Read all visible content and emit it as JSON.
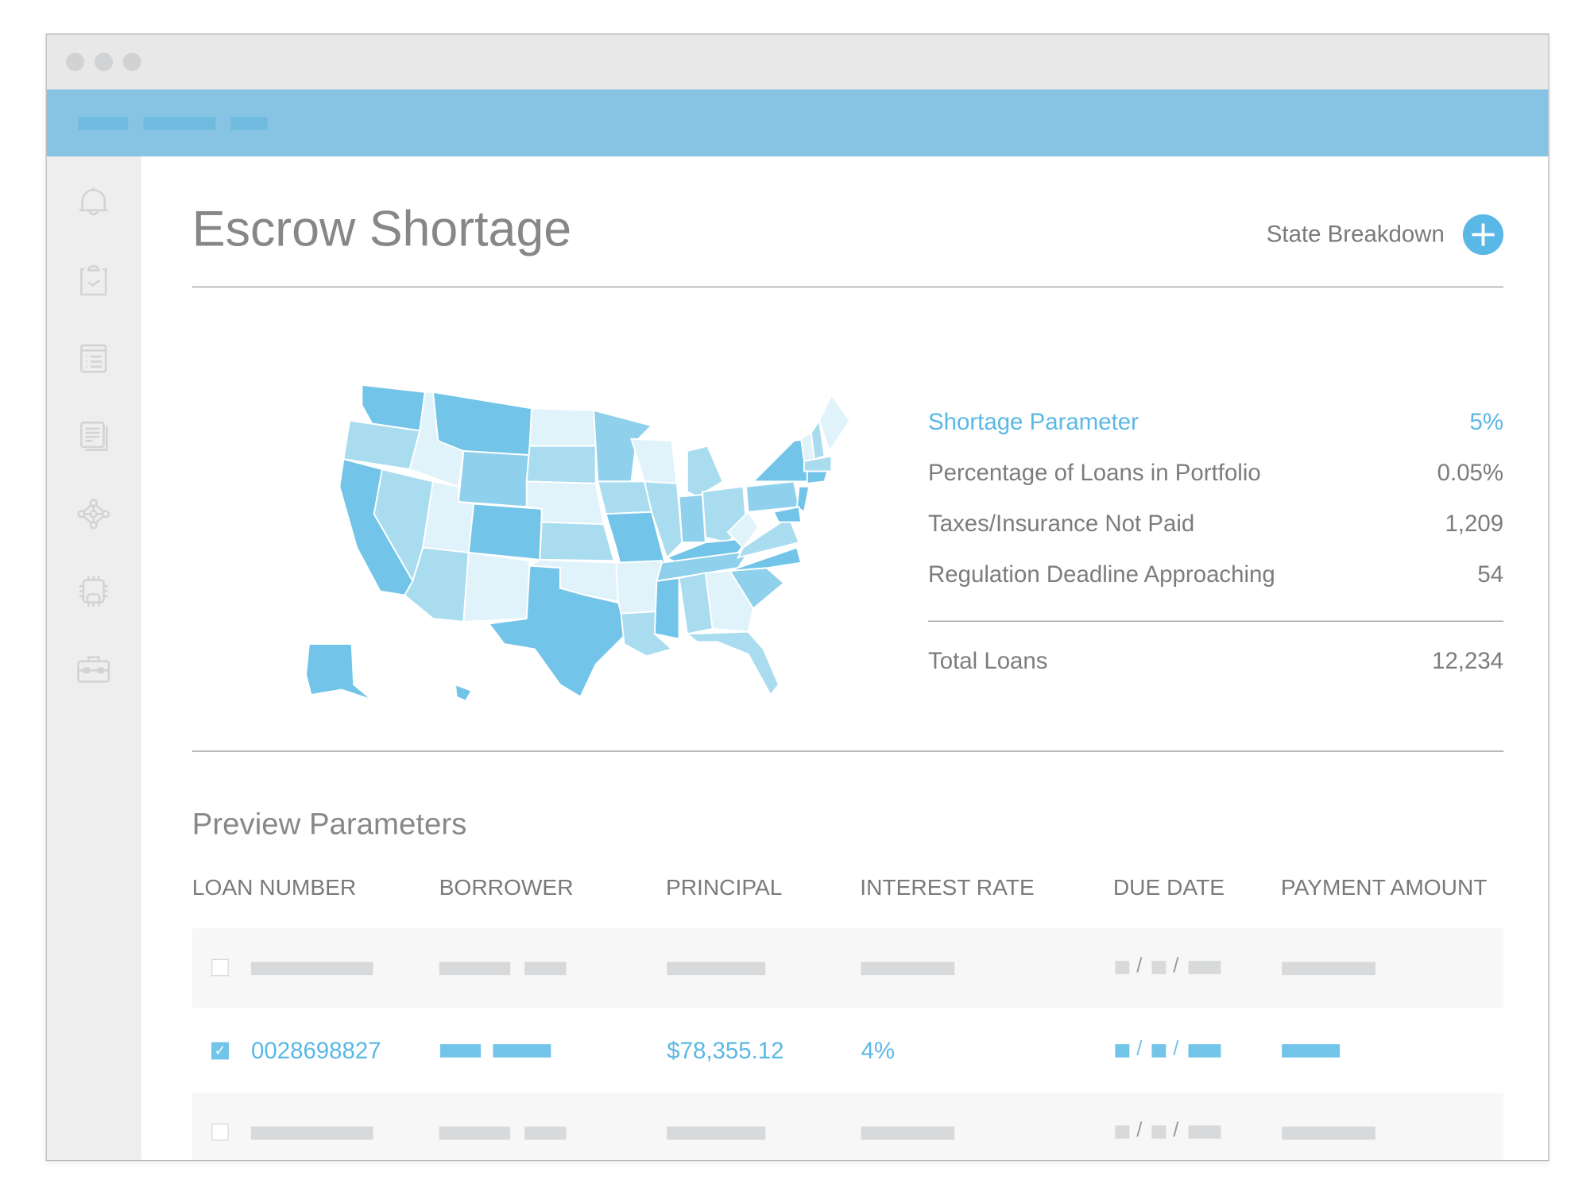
{
  "window": {
    "controls": [
      "close",
      "minimize",
      "maximize"
    ]
  },
  "sidebar": {
    "items": [
      {
        "icon": "bell-icon"
      },
      {
        "icon": "clipboard-check-icon"
      },
      {
        "icon": "list-icon"
      },
      {
        "icon": "documents-icon"
      },
      {
        "icon": "network-icon"
      },
      {
        "icon": "chip-icon"
      },
      {
        "icon": "briefcase-icon"
      }
    ]
  },
  "header": {
    "title": "Escrow Shortage",
    "state_breakdown_label": "State Breakdown",
    "add_icon": "plus-circle-icon"
  },
  "colors": {
    "accent": "#5ab8e6",
    "topbar": "#87c4e3",
    "map_shades": [
      "#72c4e8",
      "#8fd0ec",
      "#aadcf0",
      "#e0f2fa"
    ]
  },
  "stats": {
    "rows": [
      {
        "label": "Shortage Parameter",
        "value": "5%"
      },
      {
        "label": "Percentage of Loans in Portfolio",
        "value": "0.05%"
      },
      {
        "label": "Taxes/Insurance Not Paid",
        "value": "1,209"
      },
      {
        "label": "Regulation Deadline Approaching",
        "value": "54"
      }
    ],
    "total": {
      "label": "Total Loans",
      "value": "12,234"
    }
  },
  "preview": {
    "title": "Preview Parameters",
    "columns": [
      "LOAN NUMBER",
      "BORROWER",
      "PRINCIPAL",
      "INTEREST RATE",
      "DUE DATE",
      "PAYMENT AMOUNT"
    ],
    "rows": [
      {
        "checked": false
      },
      {
        "checked": true,
        "loan_number": "0028698827",
        "principal": "$78,355.12",
        "interest_rate": "4%"
      },
      {
        "checked": false
      }
    ],
    "date_sep": "/",
    "check_mark": "✓"
  }
}
